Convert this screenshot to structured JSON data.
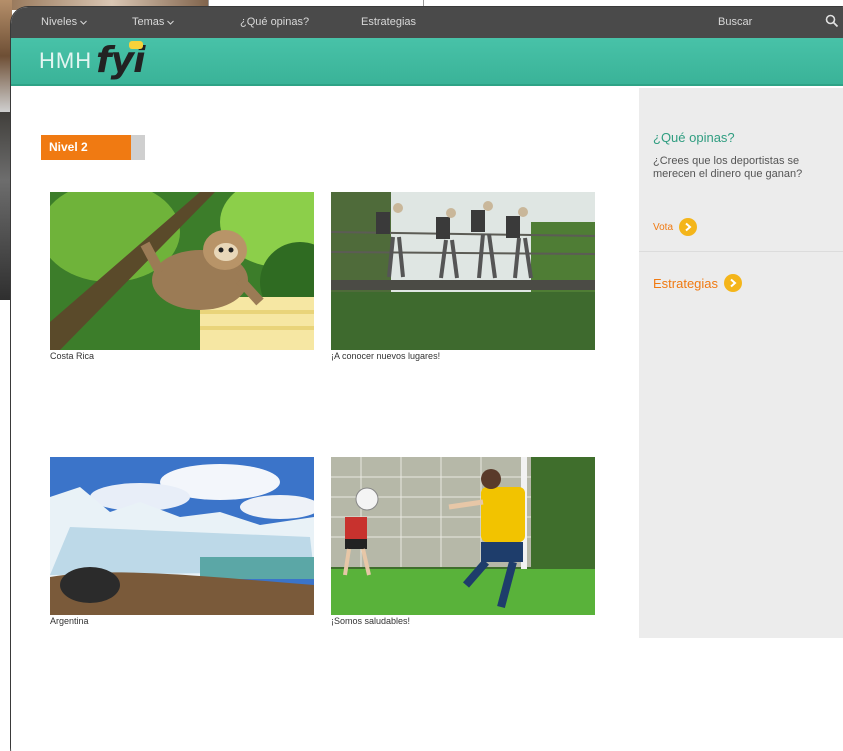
{
  "nav": {
    "items": [
      {
        "label": "Niveles",
        "has_chevron": true
      },
      {
        "label": "Temas",
        "has_chevron": true
      },
      {
        "label": "¿Qué opinas?",
        "has_chevron": false
      },
      {
        "label": "Estrategias",
        "has_chevron": false
      }
    ],
    "search_label": "Buscar"
  },
  "brand": {
    "hmh": "HMH",
    "fyi": "fyi"
  },
  "level": {
    "label": "Nivel 2",
    "progress": 0.87
  },
  "cards": [
    {
      "caption": "Costa Rica",
      "photo": "sloth-on-branch"
    },
    {
      "caption": "¡A conocer nuevos lugares!",
      "photo": "hikers-on-bridge"
    },
    {
      "caption": "Argentina",
      "photo": "glacier"
    },
    {
      "caption": "¡Somos saludables!",
      "photo": "girls-soccer"
    }
  ],
  "sidebar": {
    "opinion_title": "¿Qué opinas?",
    "opinion_question": "¿Crees que los deportistas se merecen el dinero que ganan?",
    "vote_label": "Vota",
    "strategies_label": "Estrategias"
  },
  "colors": {
    "nav_bg": "#4a4a4a",
    "brand_teal": "#3ab398",
    "accent_orange": "#f07a12",
    "arrow_yellow": "#f4b51a",
    "sidebar_bg": "#ececec",
    "sidebar_title_green": "#2f9d80"
  },
  "icons": {
    "search": "search-icon",
    "chevron": "chevron-down-icon",
    "arrow": "arrow-right-circle-icon"
  }
}
